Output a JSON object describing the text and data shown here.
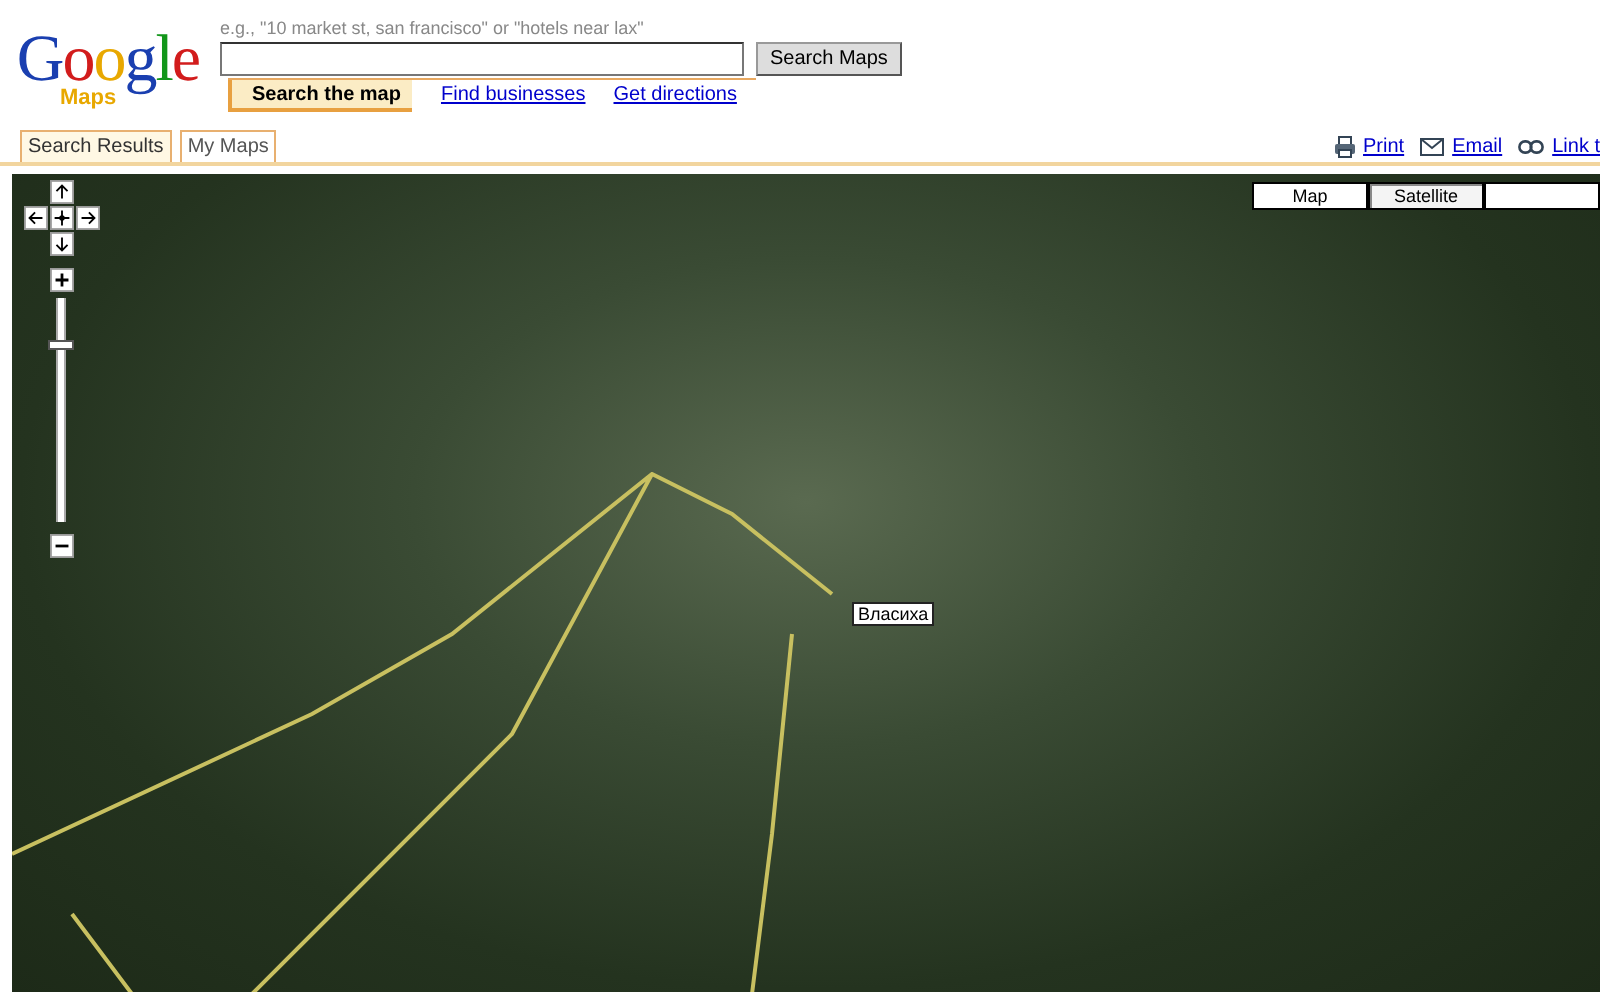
{
  "logo": {
    "word": "Google",
    "product": "Maps"
  },
  "search": {
    "hint": "e.g., \"10 market st, san francisco\" or \"hotels near lax\"",
    "button": "Search Maps"
  },
  "search_tabs": [
    {
      "label": "Search the map",
      "selected": true
    },
    {
      "label": "Find businesses",
      "selected": false
    },
    {
      "label": "Get directions",
      "selected": false
    }
  ],
  "panel_tabs": [
    {
      "label": "Search Results",
      "selected": true
    },
    {
      "label": "My Maps",
      "selected": false
    }
  ],
  "page_links": [
    {
      "kind": "print",
      "label": "Print"
    },
    {
      "kind": "email",
      "label": "Email"
    },
    {
      "kind": "link",
      "label": "Link t"
    }
  ],
  "map": {
    "types": [
      {
        "label": "Map",
        "selected": false
      },
      {
        "label": "Satellite",
        "selected": true
      },
      {
        "selected": false
      }
    ],
    "zoom": {
      "level": 0.8
    },
    "place_label": "Власиха"
  }
}
